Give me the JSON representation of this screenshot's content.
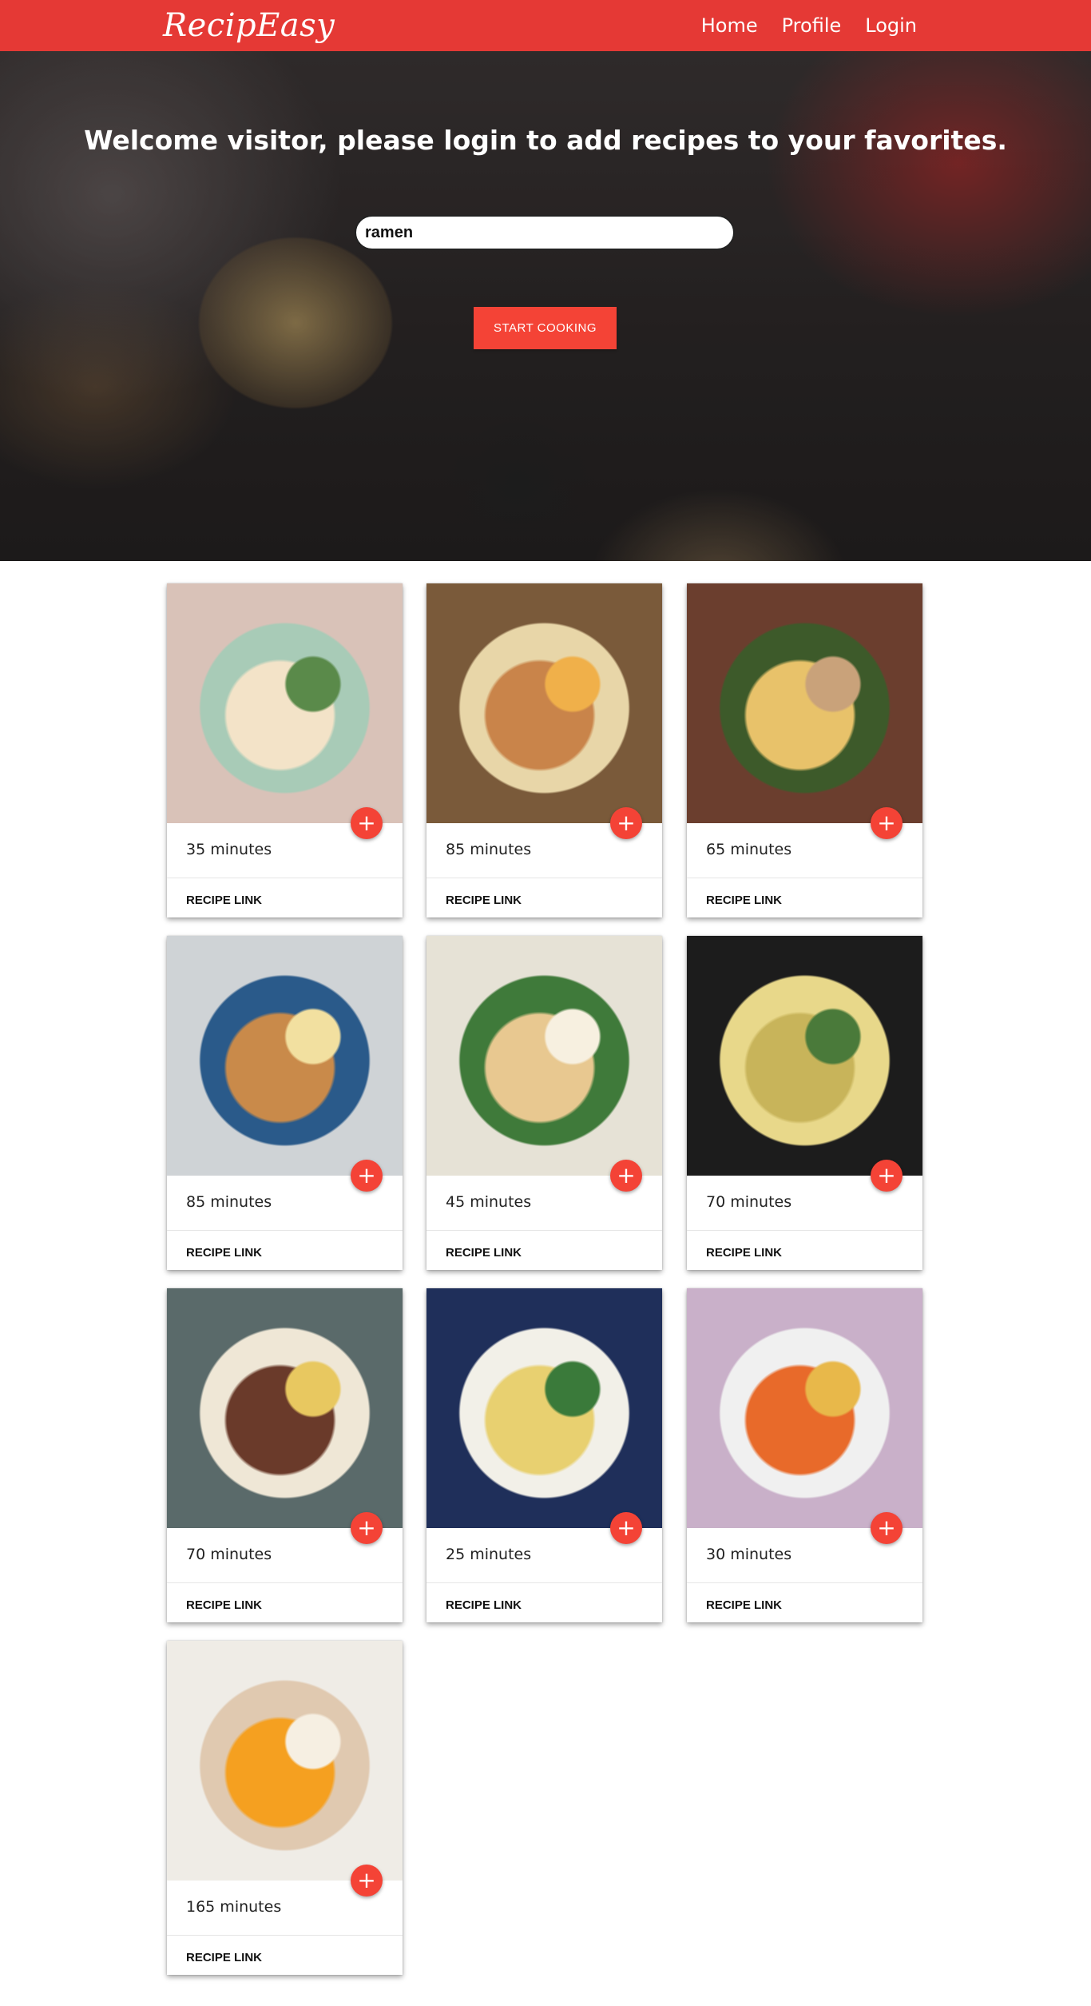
{
  "navbar": {
    "brand": "RecipEasy",
    "links": [
      "Home",
      "Profile",
      "Login"
    ],
    "color": "#e53935"
  },
  "hero": {
    "title": "Welcome visitor, please login to add recipes to your favorites.",
    "search_value": "ramen",
    "button_label": "START COOKING"
  },
  "accent_color": "#f44336",
  "cards": [
    {
      "time": "35 minutes",
      "link": "RECIPE LINK",
      "fav_icon": "+"
    },
    {
      "time": "85 minutes",
      "link": "RECIPE LINK",
      "fav_icon": "+"
    },
    {
      "time": "65 minutes",
      "link": "RECIPE LINK",
      "fav_icon": "+"
    },
    {
      "time": "85 minutes",
      "link": "RECIPE LINK",
      "fav_icon": "+"
    },
    {
      "time": "45 minutes",
      "link": "RECIPE LINK",
      "fav_icon": "+"
    },
    {
      "time": "70 minutes",
      "link": "RECIPE LINK",
      "fav_icon": "+"
    },
    {
      "time": "70 minutes",
      "link": "RECIPE LINK",
      "fav_icon": "+"
    },
    {
      "time": "25 minutes",
      "link": "RECIPE LINK",
      "fav_icon": "+"
    },
    {
      "time": "30 minutes",
      "link": "RECIPE LINK",
      "fav_icon": "+"
    },
    {
      "time": "165 minutes",
      "link": "RECIPE LINK",
      "fav_icon": "+"
    }
  ]
}
